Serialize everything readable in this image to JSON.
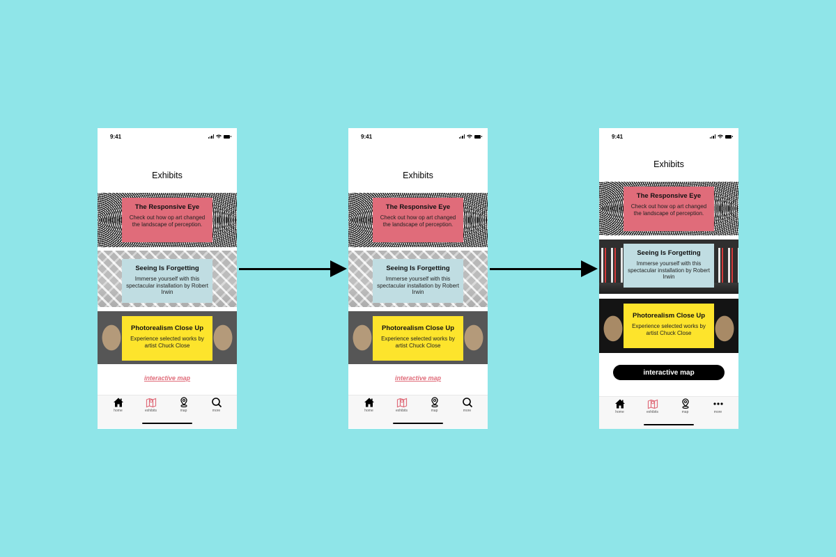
{
  "screens": [
    {
      "status_time": "9:41",
      "title": "Exhibits",
      "exhibits": [
        {
          "title": "The Responsive Eye",
          "description": "Check out how op art changed the landscape of perception."
        },
        {
          "title": "Seeing Is Forgetting",
          "description": "Immerse yourself with this spectacular installation by Robert Irwin"
        },
        {
          "title": "Photorealism Close Up",
          "description": "Experience selected works by artist Chuck Close"
        }
      ],
      "map_label": "interactive map",
      "tabs": [
        {
          "label": "home",
          "icon": "home-icon"
        },
        {
          "label": "exhibits",
          "icon": "map-folded-icon"
        },
        {
          "label": "map",
          "icon": "location-pin-icon"
        },
        {
          "label": "more",
          "icon": "search-icon"
        }
      ]
    },
    {
      "status_time": "9:41",
      "title": "Exhibits",
      "exhibits": [
        {
          "title": "The Responsive Eye",
          "description": "Check out how op art changed the landscape of perception."
        },
        {
          "title": "Seeing Is Forgetting",
          "description": "Immerse yourself with this spectacular installation by Robert Irwin"
        },
        {
          "title": "Photorealism Close Up",
          "description": "Experience selected works by artist Chuck Close"
        }
      ],
      "map_label": "interactive map",
      "tabs": [
        {
          "label": "home",
          "icon": "home-icon"
        },
        {
          "label": "exhibits",
          "icon": "map-folded-icon"
        },
        {
          "label": "map",
          "icon": "location-pin-icon"
        },
        {
          "label": "more",
          "icon": "search-icon"
        }
      ]
    },
    {
      "status_time": "9:41",
      "title": "Exhibits",
      "exhibits": [
        {
          "title": "The Responsive Eye",
          "description": "Check out how op art changed the landscape of perception."
        },
        {
          "title": "Seeing Is Forgetting",
          "description": "Immerse yourself with this spectacular installation by Robert Irwin"
        },
        {
          "title": "Photorealism Close Up",
          "description": "Experience selected works by artist Chuck Close"
        }
      ],
      "map_label": "interactive map",
      "tabs": [
        {
          "label": "home",
          "icon": "home-icon"
        },
        {
          "label": "exhibits",
          "icon": "map-folded-icon"
        },
        {
          "label": "map",
          "icon": "location-pin-icon"
        },
        {
          "label": "more",
          "icon": "more-dots-icon"
        }
      ]
    }
  ],
  "colors": {
    "background": "#8fe5e8",
    "accent_pink": "#e06c7a",
    "card_blue": "#c0dde2",
    "card_yellow": "#fde42c"
  }
}
